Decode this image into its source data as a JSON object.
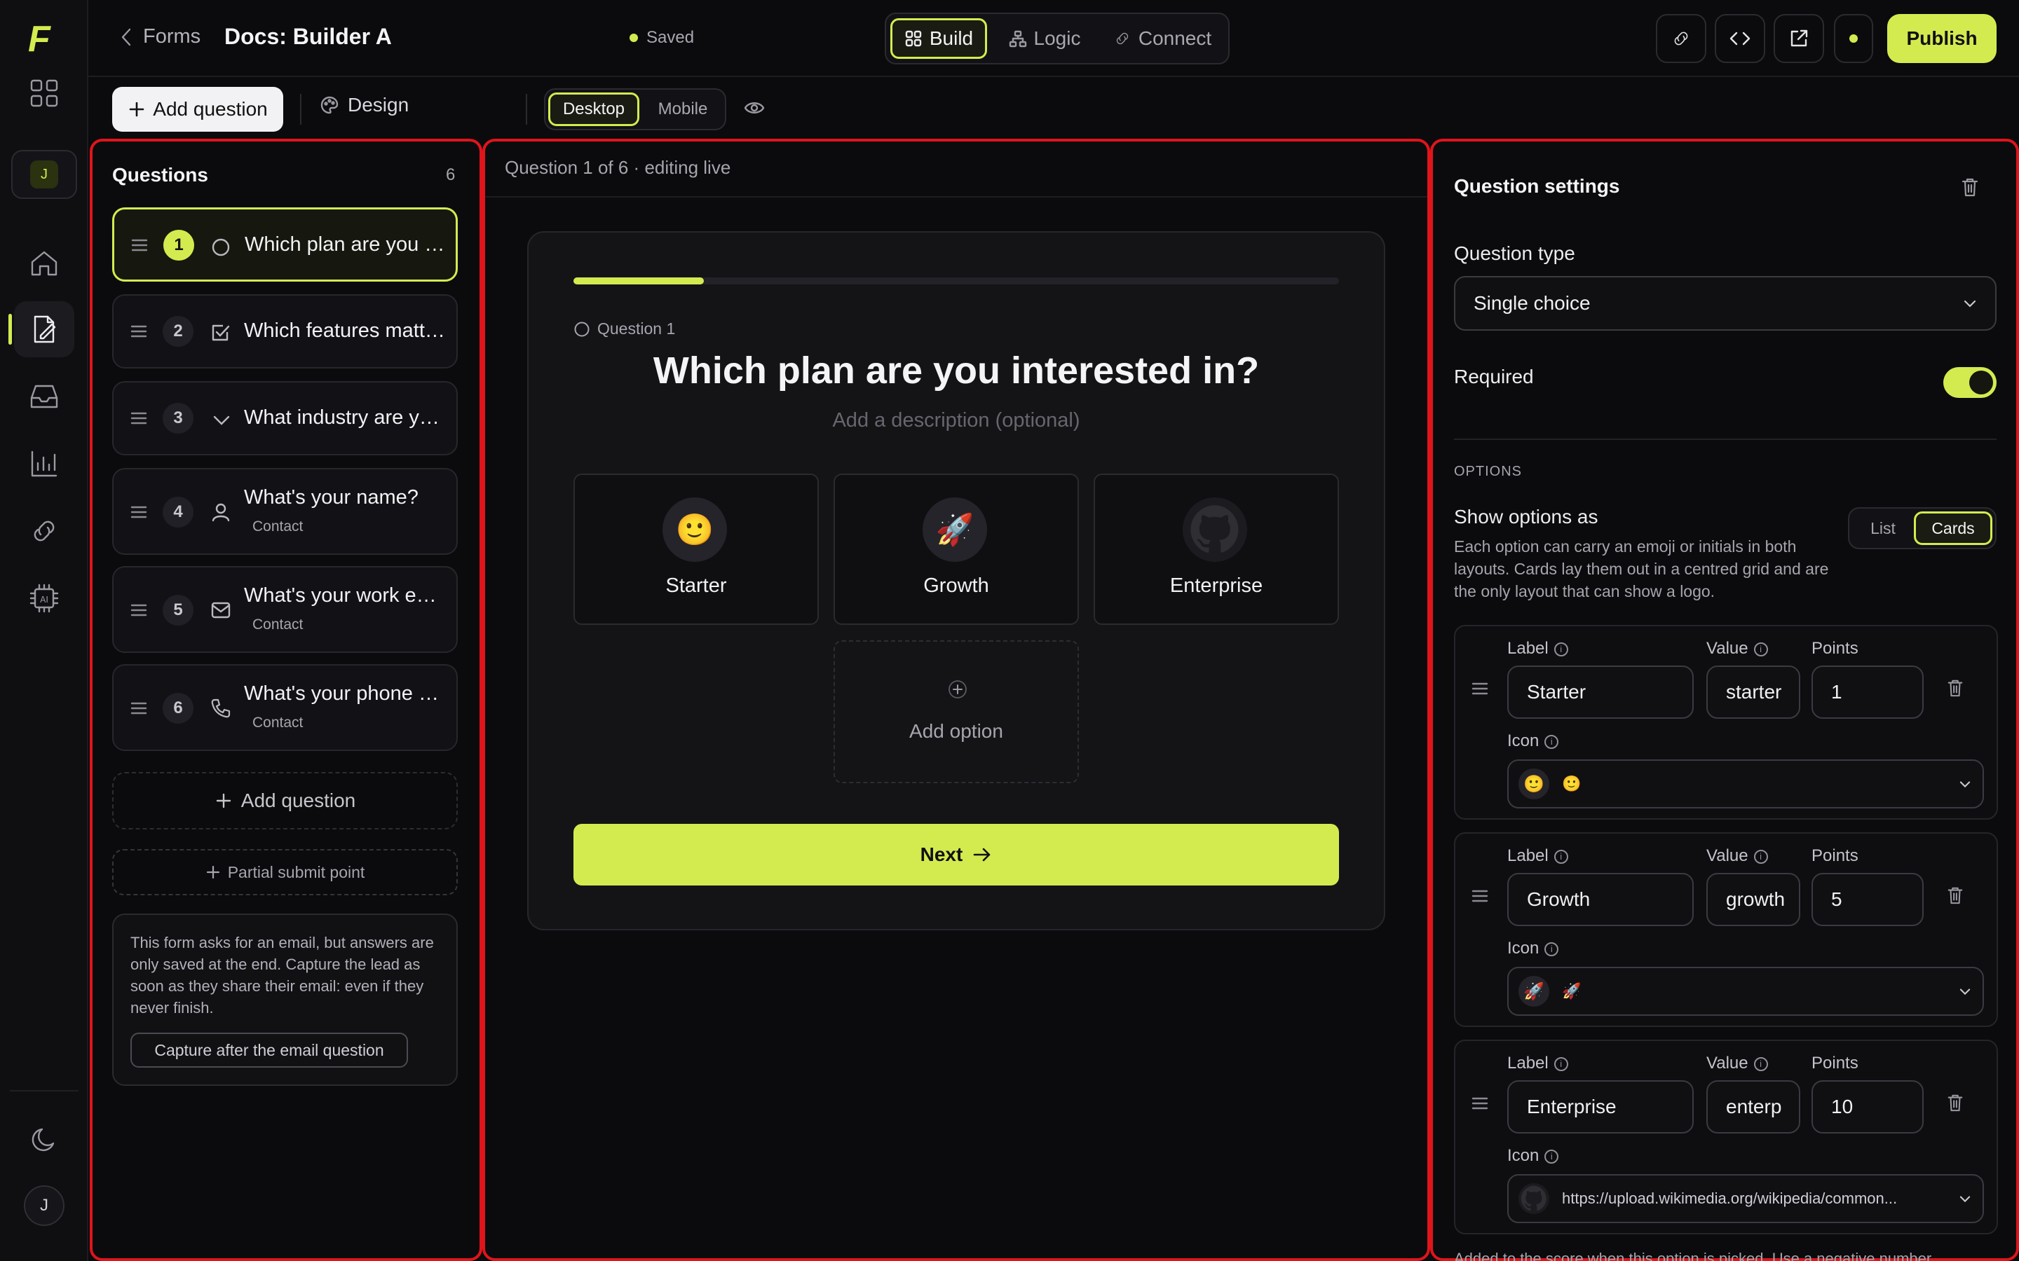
{
  "app": {
    "logo": "F"
  },
  "rail": {
    "workspace_initial": "J",
    "avatar_initial": "J"
  },
  "topbar": {
    "back_label": "Forms",
    "doc_title": "Docs: Builder A",
    "save_status": "Saved",
    "tabs": [
      {
        "label": "Build",
        "active": true
      },
      {
        "label": "Logic",
        "active": false
      },
      {
        "label": "Connect",
        "active": false
      }
    ],
    "publish_label": "Publish"
  },
  "subbar": {
    "add_question_label": "Add question",
    "design_label": "Design",
    "device_options": [
      "Desktop",
      "Mobile"
    ],
    "device_selected": "Desktop"
  },
  "questions_panel": {
    "title": "Questions",
    "count": "6",
    "items": [
      {
        "num": "1",
        "text": "Which plan are you interested in?",
        "sub": "",
        "icon": "radio-icon"
      },
      {
        "num": "2",
        "text": "Which features matter most?",
        "sub": "",
        "icon": "checkbox-icon"
      },
      {
        "num": "3",
        "text": "What industry are you in?",
        "sub": "",
        "icon": "chevron-down-icon"
      },
      {
        "num": "4",
        "text": "What's your name?",
        "sub": "Contact",
        "icon": "user-icon"
      },
      {
        "num": "5",
        "text": "What's your work email?",
        "sub": "Contact",
        "icon": "mail-icon"
      },
      {
        "num": "6",
        "text": "What's your phone number?",
        "sub": "Contact",
        "icon": "phone-icon"
      }
    ],
    "add_question_label": "Add question",
    "partial_submit_label": "Partial submit point",
    "notice_text": "This form asks for an email, but answers are only saved at the end. Capture the lead as soon as they share their email: even if they never finish.",
    "notice_button": "Capture after the email question"
  },
  "editor": {
    "status": "Question 1 of 6 · editing live",
    "progress": 0.17,
    "question_tag": "Question 1",
    "question_title": "Which plan are you interested in?",
    "description_placeholder": "Add a description (optional)",
    "options": [
      {
        "label": "Starter",
        "emoji": "🙂"
      },
      {
        "label": "Growth",
        "emoji": "🚀"
      },
      {
        "label": "Enterprise",
        "emoji": "github-logo"
      }
    ],
    "add_option_label": "Add option",
    "next_label": "Next"
  },
  "settings": {
    "title": "Question settings",
    "type_label": "Question type",
    "type_value": "Single choice",
    "required_label": "Required",
    "required_on": true,
    "options_heading": "OPTIONS",
    "show_as_label": "Show options as",
    "show_as_help": "Each option can carry an emoji or initials in both layouts. Cards lay them out in a centred grid and are the only layout that can show a logo.",
    "show_as_choices": [
      "List",
      "Cards"
    ],
    "show_as_selected": "Cards",
    "field_labels": {
      "label": "Label",
      "value": "Value",
      "points": "Points",
      "icon": "Icon"
    },
    "options": [
      {
        "label": "Starter",
        "value": "starter",
        "points": "1",
        "icon_text": "🙂"
      },
      {
        "label": "Growth",
        "value": "growth",
        "points": "5",
        "icon_text": "🚀"
      },
      {
        "label": "Enterprise",
        "value": "enterp",
        "points": "10",
        "icon_text": "https://upload.wikimedia.org/wikipedia/common..."
      }
    ],
    "footer_hint": "Added to the score when this option is picked. Use a negative number..."
  },
  "colors": {
    "accent": "#d4eb50",
    "background": "#0b0b0d",
    "highlight_border": "#e0141b"
  }
}
